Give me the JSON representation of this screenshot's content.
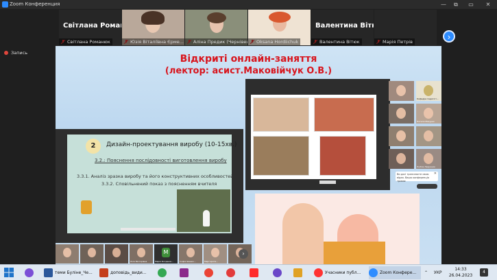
{
  "window": {
    "title": "Zoom Конференция",
    "controls": [
      "—",
      "⧉",
      "▭",
      "✕"
    ]
  },
  "participants_strip": [
    {
      "big_name": "Світлана Роман...",
      "caption": "Світлана Романюк",
      "video": false
    },
    {
      "caption": "Юзія Віталіївна Єрме...",
      "video": true
    },
    {
      "caption": "Аліна Предик (Чернівець...",
      "video": true
    },
    {
      "caption": "Oksana Hordiichuk",
      "video": true
    },
    {
      "big_name": "Валентина Вітюк",
      "caption": "Валентина Вітюк",
      "video": false
    },
    {
      "caption": "Марія Петрів",
      "video": false
    }
  ],
  "recording": {
    "label": "Запись"
  },
  "slide": {
    "title_line1": "Відкриті онлайн-заняття",
    "title_line2": "(лектор: асист.Маковійчук О.В.)",
    "ppt": {
      "number": "2",
      "heading": "Дизайн-проектування виробу (10-15хв.)",
      "subheading": "3.2.: Пояснення послідовності виготовлення виробу",
      "line1": "3.3.1. Аналіз зразка виробу та його конструктивних особливостей",
      "line2": "3.3.2. Сповільнений показ з поясненням вчителя"
    }
  },
  "gallery": [
    {
      "caption": ""
    },
    {
      "caption": "Кафедра педагогі..."
    },
    {
      "caption": ""
    },
    {
      "caption": "Наталя Мазурик"
    },
    {
      "caption": ""
    },
    {
      "caption": ""
    },
    {
      "caption": ""
    },
    {
      "caption": "Любов Лавринюк"
    }
  ],
  "tooltip": {
    "text": "Ви досі транслюєте свою відео. Ваша конференція триває"
  },
  "bottom_row": [
    {
      "caption": ""
    },
    {
      "caption": ""
    },
    {
      "caption": ""
    },
    {
      "caption": "Ліля Вікторівна"
    },
    {
      "caption": "Марія Богданів..."
    },
    {
      "caption": "Софія Іванюк..."
    },
    {
      "caption": "Маргарита..."
    },
    {
      "caption": ""
    }
  ],
  "taskbar": {
    "items": [
      {
        "label": "",
        "icon": "cortana-icon",
        "color": "#7b4fd6"
      },
      {
        "label": "теми Буліне_Че...",
        "icon": "word-icon",
        "color": "#2b579a"
      },
      {
        "label": "доповідь_види...",
        "icon": "powerpoint-icon",
        "color": "#c43e1c"
      },
      {
        "label": "",
        "icon": "chrome-icon",
        "color": "#34a853"
      },
      {
        "label": "",
        "icon": "winrar-icon",
        "color": "#8b2a8b"
      },
      {
        "label": "",
        "icon": "chrome-icon-2",
        "color": "#ea4335"
      },
      {
        "label": "",
        "icon": "opera-icon",
        "color": "#e23b3b"
      },
      {
        "label": "",
        "icon": "yandex-icon",
        "color": "#ff2b2b"
      },
      {
        "label": "",
        "icon": "app-icon",
        "color": "#6a47c8"
      },
      {
        "label": "",
        "icon": "files-icon",
        "color": "#e0a225"
      },
      {
        "label": "Учасники публ...",
        "icon": "yandex-browser-icon",
        "color": "#ff3333"
      },
      {
        "label": "Zoom Конфере...",
        "icon": "zoom-icon",
        "color": "#2d8cff"
      }
    ],
    "language": "УКР",
    "time": "14:33",
    "date": "26.04.2023",
    "notifications": "4"
  }
}
